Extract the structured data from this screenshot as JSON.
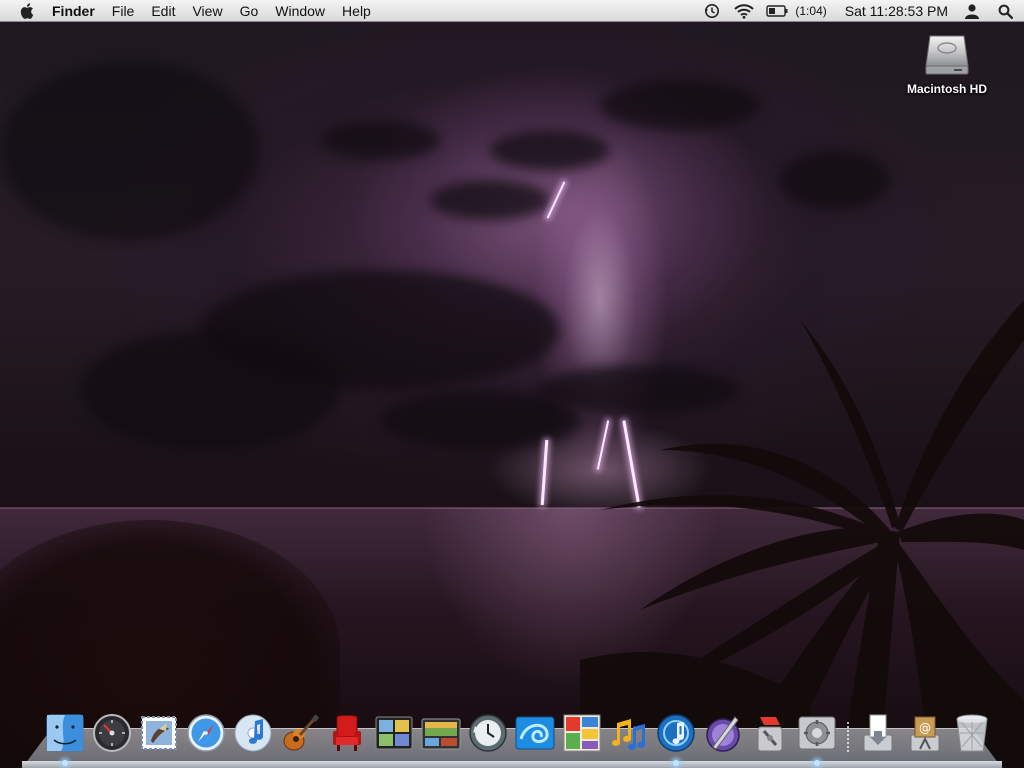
{
  "menubar": {
    "apple_icon": "apple-logo-icon",
    "items": [
      {
        "label": "Finder",
        "bold": true
      },
      {
        "label": "File"
      },
      {
        "label": "Edit"
      },
      {
        "label": "View"
      },
      {
        "label": "Go"
      },
      {
        "label": "Window"
      },
      {
        "label": "Help"
      }
    ],
    "status": {
      "time_machine_icon": "time-machine-icon",
      "wifi_icon": "wifi-icon",
      "battery_icon": "battery-icon",
      "battery_time": "(1:04)",
      "clock": "Sat 11:28:53 PM",
      "user_icon": "user-icon",
      "spotlight_icon": "spotlight-search-icon"
    }
  },
  "desktop": {
    "icons": [
      {
        "label": "Macintosh HD",
        "icon": "hard-drive-icon"
      }
    ],
    "wallpaper": "night lightning storm over sea with palm silhouettes"
  },
  "dock": {
    "apps": [
      {
        "name": "Finder",
        "icon": "finder-icon",
        "running": true
      },
      {
        "name": "Dashboard",
        "icon": "dashboard-icon",
        "running": false
      },
      {
        "name": "Mail",
        "icon": "mail-icon",
        "running": false
      },
      {
        "name": "Safari",
        "icon": "safari-icon",
        "running": false
      },
      {
        "name": "iTunes",
        "icon": "itunes-icon",
        "running": false
      },
      {
        "name": "GarageBand",
        "icon": "garageband-icon",
        "running": false
      },
      {
        "name": "Front Row",
        "icon": "front-row-icon",
        "running": false
      },
      {
        "name": "Photo Booth",
        "icon": "photo-booth-icon",
        "running": false
      },
      {
        "name": "iPhoto",
        "icon": "iphoto-icon",
        "running": false
      },
      {
        "name": "Time Machine",
        "icon": "time-machine-app-icon",
        "running": false
      },
      {
        "name": "Screen Saver",
        "icon": "blue-swirl-icon",
        "running": false
      },
      {
        "name": "iWeb",
        "icon": "collage-icon",
        "running": false
      },
      {
        "name": "Music Notes",
        "icon": "music-notes-icon",
        "running": false
      },
      {
        "name": "Audio",
        "icon": "audio-icon",
        "running": true
      },
      {
        "name": "Script Editor",
        "icon": "script-editor-icon",
        "running": false
      },
      {
        "name": "Xcode Tools",
        "icon": "developer-tools-icon",
        "running": false
      },
      {
        "name": "System Preferences",
        "icon": "system-preferences-icon",
        "running": true
      }
    ],
    "stacks": [
      {
        "name": "Downloads",
        "icon": "downloads-stack-icon"
      },
      {
        "name": "Documents",
        "icon": "documents-stack-icon"
      },
      {
        "name": "Trash",
        "icon": "trash-icon"
      }
    ]
  }
}
